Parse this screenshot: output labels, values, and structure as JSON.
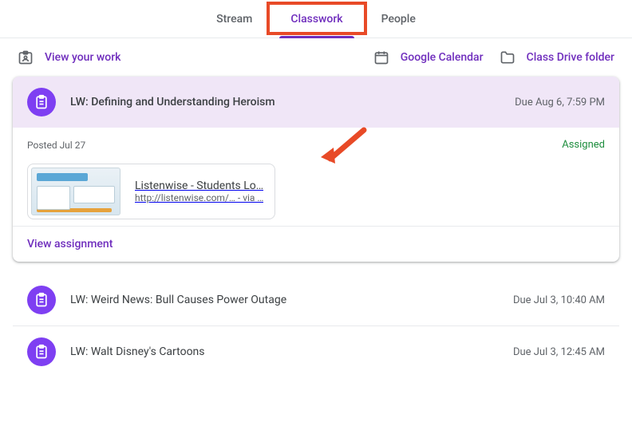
{
  "tabs": {
    "stream": "Stream",
    "classwork": "Classwork",
    "people": "People"
  },
  "toolbar": {
    "view_work": "View your work",
    "calendar": "Google Calendar",
    "drive_folder": "Class Drive folder"
  },
  "expanded": {
    "title": "LW: Defining and Understanding Heroism",
    "due": "Due Aug 6, 7:59 PM",
    "posted": "Posted Jul 27",
    "status": "Assigned",
    "attachment": {
      "title": "Listenwise - Students Lo…",
      "sub": "http://listenwise.com/…   - via …"
    },
    "view_assignment": "View assignment"
  },
  "rows": [
    {
      "title": "LW: Weird News: Bull Causes Power Outage",
      "due": "Due Jul 3, 10:40 AM"
    },
    {
      "title": "LW: Walt Disney's Cartoons",
      "due": "Due Jul 3, 12:45 AM"
    }
  ]
}
